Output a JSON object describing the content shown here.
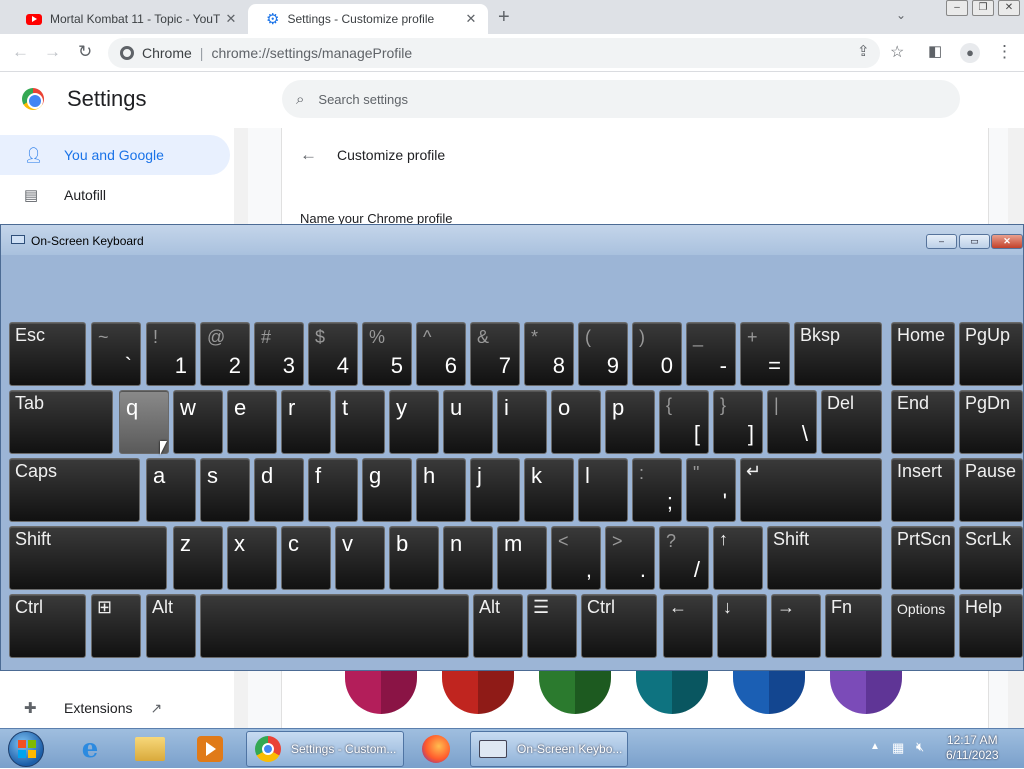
{
  "browser": {
    "tabs": [
      {
        "title": "Mortal Kombat 11 - Topic - YouTu",
        "icon": "youtube-icon",
        "active": false
      },
      {
        "title": "Settings - Customize profile",
        "icon": "settings-gear-icon",
        "active": true
      }
    ],
    "new_tab": "+",
    "omnibox": {
      "site": "Chrome",
      "separator": "|",
      "url": "chrome://settings/manageProfile"
    }
  },
  "settings": {
    "title": "Settings",
    "search_placeholder": "Search settings",
    "sidebar": [
      {
        "label": "You and Google",
        "icon": "person-icon",
        "selected": true
      },
      {
        "label": "Autofill",
        "icon": "clipboard-icon",
        "selected": false
      },
      {
        "label": "Extensions",
        "icon": "puzzle-icon",
        "selected": false
      }
    ],
    "page_heading": "Customize profile",
    "name_label": "Name your Chrome profile",
    "theme_colors": [
      [
        "#b31e5a",
        "#8a1445"
      ],
      [
        "#c0251f",
        "#8f1b17"
      ],
      [
        "#2b7a2e",
        "#1d5a20"
      ],
      [
        "#0e7380",
        "#095660"
      ],
      [
        "#1b5fb4",
        "#134690"
      ],
      [
        "#7b4bb8",
        "#5f3596"
      ]
    ]
  },
  "osk": {
    "title": "On-Screen Keyboard",
    "rows": [
      [
        {
          "t": "Esc"
        },
        {
          "s": "~",
          "b": "`"
        },
        {
          "s": "!",
          "b": "1"
        },
        {
          "s": "@",
          "b": "2"
        },
        {
          "s": "#",
          "b": "3"
        },
        {
          "s": "$",
          "b": "4"
        },
        {
          "s": "%",
          "b": "5"
        },
        {
          "s": "^",
          "b": "6"
        },
        {
          "s": "&",
          "b": "7"
        },
        {
          "s": "*",
          "b": "8"
        },
        {
          "s": "(",
          "b": "9"
        },
        {
          "s": ")",
          "b": "0"
        },
        {
          "s": "_",
          "b": "-"
        },
        {
          "s": "+",
          "b": "="
        },
        {
          "t": "Bksp"
        },
        {
          "t": "Home"
        },
        {
          "t": "PgUp"
        }
      ],
      [
        {
          "t": "Tab"
        },
        {
          "c": "q"
        },
        {
          "c": "w"
        },
        {
          "c": "e"
        },
        {
          "c": "r"
        },
        {
          "c": "t"
        },
        {
          "c": "y"
        },
        {
          "c": "u"
        },
        {
          "c": "i"
        },
        {
          "c": "o"
        },
        {
          "c": "p"
        },
        {
          "s": "{",
          "b": "["
        },
        {
          "s": "}",
          "b": "]"
        },
        {
          "s": "|",
          "b": "\\"
        },
        {
          "t": "Del"
        },
        {
          "t": "End"
        },
        {
          "t": "PgDn"
        }
      ],
      [
        {
          "t": "Caps"
        },
        {
          "c": "a"
        },
        {
          "c": "s"
        },
        {
          "c": "d"
        },
        {
          "c": "f"
        },
        {
          "c": "g"
        },
        {
          "c": "h"
        },
        {
          "c": "j"
        },
        {
          "c": "k"
        },
        {
          "c": "l"
        },
        {
          "s": ":",
          "b": ";"
        },
        {
          "s": "\"",
          "b": "'"
        },
        {
          "t": "↵"
        },
        {
          "t": "Insert"
        },
        {
          "t": "Pause"
        }
      ],
      [
        {
          "t": "Shift"
        },
        {
          "c": "z"
        },
        {
          "c": "x"
        },
        {
          "c": "c"
        },
        {
          "c": "v"
        },
        {
          "c": "b"
        },
        {
          "c": "n"
        },
        {
          "c": "m"
        },
        {
          "s": "<",
          "b": ","
        },
        {
          "s": ">",
          "b": "."
        },
        {
          "s": "?",
          "b": "/"
        },
        {
          "t": "↑"
        },
        {
          "t": "Shift"
        },
        {
          "t": "PrtScn"
        },
        {
          "t": "ScrLk"
        }
      ],
      [
        {
          "t": "Ctrl"
        },
        {
          "t": "⊞"
        },
        {
          "t": "Alt"
        },
        {
          "t": ""
        },
        {
          "t": "Alt"
        },
        {
          "t": "☰"
        },
        {
          "t": "Ctrl"
        },
        {
          "t": "←"
        },
        {
          "t": "↓"
        },
        {
          "t": "→"
        },
        {
          "t": "Fn"
        },
        {
          "t": "Options"
        },
        {
          "t": "Help"
        }
      ]
    ],
    "pressed_key": "q"
  },
  "taskbar": {
    "pinned": [
      "internet-explorer-icon",
      "file-explorer-icon",
      "media-player-icon"
    ],
    "buttons": [
      {
        "label": "Settings - Custom...",
        "icon": "chrome-icon"
      },
      {
        "label": "",
        "icon": "firefox-icon"
      },
      {
        "label": "On-Screen Keybo...",
        "icon": "keyboard-icon"
      }
    ],
    "clock_time": "12:17 AM",
    "clock_date": "6/11/2023"
  }
}
